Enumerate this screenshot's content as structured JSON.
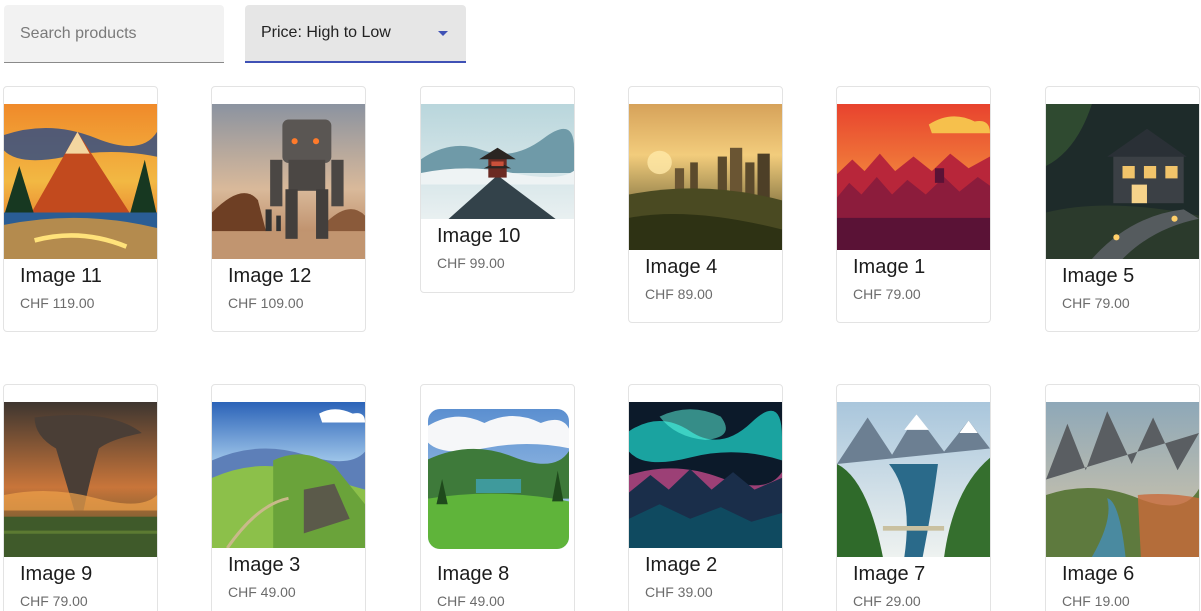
{
  "search": {
    "placeholder": "Search products",
    "value": ""
  },
  "sort": {
    "label": "Price: High to Low"
  },
  "colors": {
    "accent": "#3f51b5"
  },
  "products": [
    {
      "title": "Image 11",
      "price": "CHF 119.00",
      "art": "mountain-sunset-painting"
    },
    {
      "title": "Image 12",
      "price": "CHF 109.00",
      "art": "robot-desert"
    },
    {
      "title": "Image 10",
      "price": "CHF 99.00",
      "art": "temple-on-peak"
    },
    {
      "title": "Image 4",
      "price": "CHF 89.00",
      "art": "city-sunrise"
    },
    {
      "title": "Image 1",
      "price": "CHF 79.00",
      "art": "red-forest-sunset"
    },
    {
      "title": "Image 5",
      "price": "CHF 79.00",
      "art": "house-at-night"
    },
    {
      "title": "Image 9",
      "price": "CHF 79.00",
      "art": "tornado-field"
    },
    {
      "title": "Image 3",
      "price": "CHF 49.00",
      "art": "green-hills"
    },
    {
      "title": "Image 8",
      "price": "CHF 49.00",
      "art": "meadow-clouds"
    },
    {
      "title": "Image 2",
      "price": "CHF 39.00",
      "art": "aurora-mountains"
    },
    {
      "title": "Image 7",
      "price": "CHF 29.00",
      "art": "river-valley"
    },
    {
      "title": "Image 6",
      "price": "CHF 19.00",
      "art": "mountain-river-fantasy"
    }
  ]
}
